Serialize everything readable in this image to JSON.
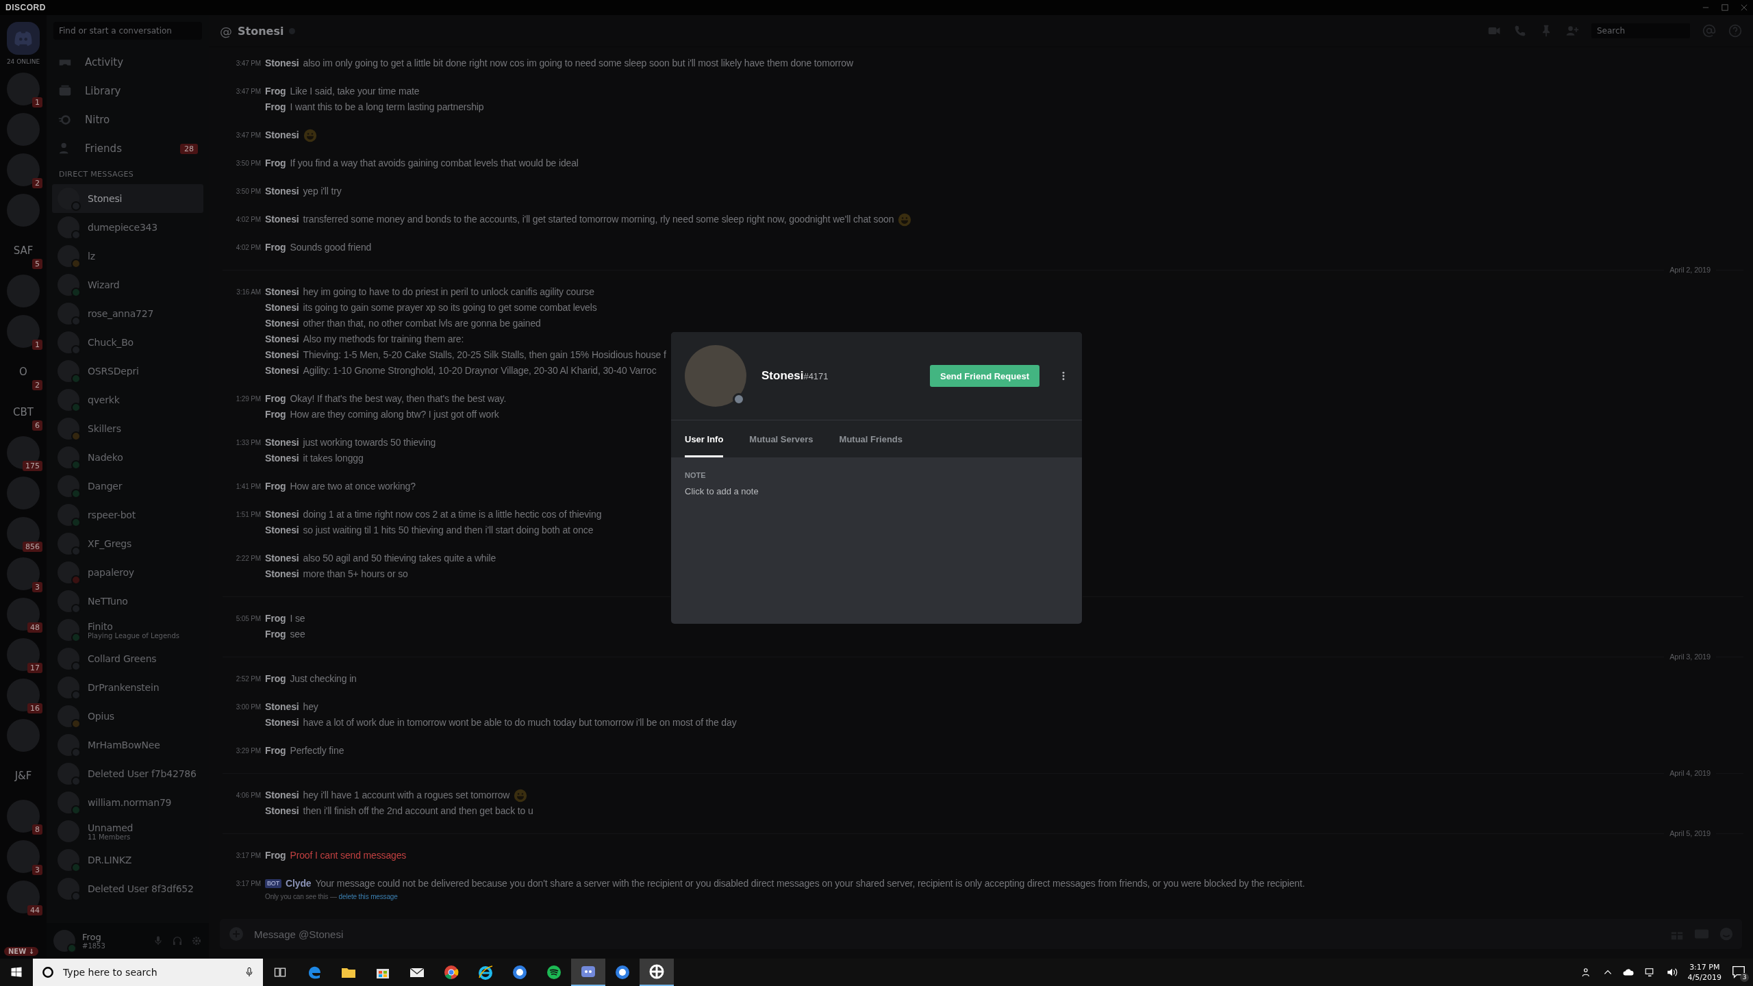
{
  "titlebar": {
    "app_name": "DISCORD"
  },
  "servers": {
    "home_label": "24 ONLINE",
    "new_pill": "NEW ↓",
    "items": [
      {
        "kind": "image",
        "badge": "1"
      },
      {
        "kind": "image"
      },
      {
        "kind": "image",
        "badge": "2"
      },
      {
        "kind": "image"
      },
      {
        "kind": "text",
        "label": "SAF",
        "badge": "5"
      },
      {
        "kind": "image"
      },
      {
        "kind": "image",
        "badge": "1"
      },
      {
        "kind": "text",
        "label": "O",
        "badge": "2"
      },
      {
        "kind": "text",
        "label": "CBT",
        "badge": "6"
      },
      {
        "kind": "image",
        "badge": "175"
      },
      {
        "kind": "image"
      },
      {
        "kind": "image",
        "badge": "856"
      },
      {
        "kind": "image",
        "badge": "3"
      },
      {
        "kind": "image",
        "badge": "48"
      },
      {
        "kind": "image",
        "badge": "17"
      },
      {
        "kind": "image",
        "badge": "16"
      },
      {
        "kind": "image"
      },
      {
        "kind": "text",
        "label": "J&F"
      },
      {
        "kind": "image",
        "badge": "8"
      },
      {
        "kind": "image",
        "badge": "3"
      },
      {
        "kind": "image",
        "badge": "44"
      }
    ]
  },
  "sidebar": {
    "search_placeholder": "Find or start a conversation",
    "nav": [
      {
        "kind": "activity",
        "label": "Activity"
      },
      {
        "kind": "library",
        "label": "Library"
      },
      {
        "kind": "nitro",
        "label": "Nitro"
      },
      {
        "kind": "friends",
        "label": "Friends",
        "badge": "28"
      }
    ],
    "section_title": "DIRECT MESSAGES",
    "dms": [
      {
        "name": "Stonesi",
        "selected": true,
        "color": "#1c1e22"
      },
      {
        "name": "dumepiece343",
        "selected": false,
        "color": "#1c1e22"
      },
      {
        "name": "lz",
        "selected": false,
        "color": "#33260f"
      },
      {
        "name": "Wizard",
        "selected": false,
        "color": "#0f2a1d"
      },
      {
        "name": "rose_anna727",
        "selected": false,
        "color": "#1c1e22"
      },
      {
        "name": "Chuck_Bo",
        "selected": false,
        "color": "#1c1e22"
      },
      {
        "name": "OSRSDepri",
        "selected": false,
        "color": "#0f2a1d"
      },
      {
        "name": "qverkk",
        "selected": false,
        "color": "#0f2a1d"
      },
      {
        "name": "Skillers",
        "selected": false,
        "color": "#33260f"
      },
      {
        "name": "Nadeko",
        "selected": false,
        "color": "#0f2a1d"
      },
      {
        "name": "Danger",
        "selected": false,
        "color": "#0f2a1d"
      },
      {
        "name": "rspeer-bot",
        "selected": false,
        "color": "#0f2a1d"
      },
      {
        "name": "XF_Gregs",
        "selected": false,
        "color": "#1c1e22"
      },
      {
        "name": "papaleroy",
        "selected": false,
        "color": "#3a1111"
      },
      {
        "name": "NeTTuno",
        "selected": false,
        "color": "#1c1e22"
      },
      {
        "name": "Finito",
        "subtitle": "Playing League of Legends",
        "selected": false,
        "color": "#0f2a1d"
      },
      {
        "name": "Collard Greens",
        "selected": false,
        "color": "#1c1e22"
      },
      {
        "name": "DrPrankenstein",
        "selected": false,
        "color": "#1c1e22"
      },
      {
        "name": "Opius",
        "selected": false,
        "color": "#33260f"
      },
      {
        "name": "MrHamBowNee",
        "selected": false,
        "color": "#1c1e22"
      },
      {
        "name": "Deleted User f7b42786",
        "selected": false,
        "color": "#1c1e22"
      },
      {
        "name": "william.norman79",
        "selected": false,
        "color": "#0f2a1d"
      },
      {
        "name": "Unnamed",
        "subtitle": "11 Members",
        "selected": false
      },
      {
        "name": "DR.LINKZ",
        "selected": false,
        "color": "#0f2a1d"
      },
      {
        "name": "Deleted User 8f3df652",
        "selected": false,
        "color": "#1c1e22"
      }
    ]
  },
  "user_panel": {
    "name": "Frog",
    "tag": "#1853"
  },
  "chat": {
    "channel_prefix": "@",
    "channel": "Stonesi",
    "search_placeholder": "Search",
    "input_placeholder": "Message @Stonesi",
    "messages": [
      {
        "kind": "group",
        "time": "3:47 PM",
        "lines": [
          {
            "author": "Stonesi",
            "text": "also im only going to get a little bit done right now cos im going to need some sleep soon but i'll most likely have them done tomorrow",
            "emoji": false,
            "failed": false
          }
        ]
      },
      {
        "kind": "group",
        "time": "3:47 PM",
        "lines": [
          {
            "author": "Frog",
            "text": "Like I said, take your time mate",
            "emoji": false,
            "failed": false
          },
          {
            "author": "Frog",
            "text": "I want this to be a long term lasting partnership",
            "emoji": false,
            "failed": false
          }
        ]
      },
      {
        "kind": "group",
        "time": "3:47 PM",
        "lines": [
          {
            "author": "Stonesi",
            "emoji": true
          }
        ]
      },
      {
        "kind": "group",
        "time": "3:50 PM",
        "lines": [
          {
            "author": "Frog",
            "text": "If you find a way that avoids gaining combat levels that would be ideal",
            "emoji": false,
            "failed": false
          }
        ]
      },
      {
        "kind": "group",
        "time": "3:50 PM",
        "lines": [
          {
            "author": "Stonesi",
            "text": "yep i'll try",
            "emoji": false,
            "failed": false
          }
        ]
      },
      {
        "kind": "group",
        "time": "4:02 PM",
        "lines": [
          {
            "author": "Stonesi",
            "text": "transferred some money and bonds to the accounts, i'll get started tomorrow morning, rly need some sleep right now, goodnight we'll chat soon",
            "emoji": true,
            "failed": false
          }
        ]
      },
      {
        "kind": "group",
        "time": "4:02 PM",
        "lines": [
          {
            "author": "Frog",
            "text": "Sounds good friend",
            "emoji": false,
            "failed": false
          }
        ]
      },
      {
        "kind": "divider",
        "date": "April 2, 2019"
      },
      {
        "kind": "group",
        "time": "3:16 AM",
        "lines": [
          {
            "author": "Stonesi",
            "text": "hey im going to have to do priest in peril to unlock canifis agility course",
            "emoji": false,
            "failed": false
          },
          {
            "author": "Stonesi",
            "text": "its going to gain some prayer xp so its going to get some combat levels",
            "emoji": false,
            "failed": false
          },
          {
            "author": "Stonesi",
            "text": "other than that, no other combat lvls are gonna be gained",
            "emoji": false,
            "failed": false
          },
          {
            "author": "Stonesi",
            "text": "Also my methods for training them are:",
            "emoji": false,
            "failed": false
          },
          {
            "author": "Stonesi",
            "text": "Thieving: 1-5 Men, 5-20 Cake Stalls, 20-25 Silk Stalls, then gain 15% Hosidious house f",
            "emoji": false,
            "failed": false
          },
          {
            "author": "Stonesi",
            "text": "Agility: 1-10 Gnome Stronghold, 10-20 Draynor Village, 20-30 Al Kharid, 30-40 Varroc",
            "emoji": false,
            "failed": false
          }
        ]
      },
      {
        "kind": "group",
        "time": "1:29 PM",
        "lines": [
          {
            "author": "Frog",
            "text": "Okay! If that's the best way, then that's the best way.",
            "emoji": false,
            "failed": false
          },
          {
            "author": "Frog",
            "text": "How are they coming along btw? I just got off work",
            "emoji": false,
            "failed": false
          }
        ]
      },
      {
        "kind": "group",
        "time": "1:33 PM",
        "lines": [
          {
            "author": "Stonesi",
            "text": "just working towards 50 thieving",
            "emoji": false,
            "failed": false
          },
          {
            "author": "Stonesi",
            "text": "it takes longgg",
            "emoji": false,
            "failed": false
          }
        ]
      },
      {
        "kind": "group",
        "time": "1:41 PM",
        "lines": [
          {
            "author": "Frog",
            "text": "How are two at once working?",
            "emoji": false,
            "failed": false
          }
        ]
      },
      {
        "kind": "group",
        "time": "1:51 PM",
        "lines": [
          {
            "author": "Stonesi",
            "text": "doing 1 at a time right now cos 2 at a time is a little hectic cos of thieving",
            "emoji": false,
            "failed": false
          },
          {
            "author": "Stonesi",
            "text": "so just waiting til 1 hits 50 thieving and then i'll start doing both at once",
            "emoji": false,
            "failed": false
          }
        ]
      },
      {
        "kind": "group",
        "time": "2:22 PM",
        "lines": [
          {
            "author": "Stonesi",
            "text": "also 50 agil and 50 thieving takes quite a while",
            "emoji": false,
            "failed": false
          },
          {
            "author": "Stonesi",
            "text": "more than 5+ hours or so",
            "emoji": false,
            "failed": false
          }
        ]
      },
      {
        "kind": "divider"
      },
      {
        "kind": "group",
        "time": "5:05 PM",
        "lines": [
          {
            "author": "Frog",
            "text": "I se",
            "emoji": false,
            "failed": false
          },
          {
            "author": "Frog",
            "text": "see",
            "emoji": false,
            "failed": false
          }
        ]
      },
      {
        "kind": "divider",
        "date": "April 3, 2019"
      },
      {
        "kind": "group",
        "time": "2:52 PM",
        "lines": [
          {
            "author": "Frog",
            "text": "Just checking in",
            "emoji": false,
            "failed": false
          }
        ]
      },
      {
        "kind": "group",
        "time": "3:00 PM",
        "lines": [
          {
            "author": "Stonesi",
            "text": "hey",
            "emoji": false,
            "failed": false
          },
          {
            "author": "Stonesi",
            "text": "have a lot of work due in tomorrow wont be able to do much today but tomorrow i'll be on most of the day",
            "emoji": false,
            "failed": false
          }
        ]
      },
      {
        "kind": "group",
        "time": "3:29 PM",
        "lines": [
          {
            "author": "Frog",
            "text": "Perfectly fine",
            "emoji": false,
            "failed": false
          }
        ]
      },
      {
        "kind": "divider",
        "date": "April 4, 2019"
      },
      {
        "kind": "group",
        "time": "4:06 PM",
        "lines": [
          {
            "author": "Stonesi",
            "text": "hey i'll have 1 account with a rogues set tomorrow",
            "emoji": true,
            "failed": false
          },
          {
            "author": "Stonesi",
            "text": "then i'll finish off the 2nd account and then get back to u",
            "emoji": false,
            "failed": false
          }
        ]
      },
      {
        "kind": "divider",
        "date": "April 5, 2019"
      },
      {
        "kind": "group",
        "time": "3:17 PM",
        "lines": [
          {
            "author": "Frog",
            "text": "Proof I cant send messages",
            "emoji": false,
            "failed": true
          }
        ]
      },
      {
        "kind": "system",
        "time": "3:17 PM",
        "tag": "BOT",
        "author": "Clyde",
        "text": "Your message could not be delivered because you don't share a server with the recipient or you disabled direct messages on your shared server, recipient is only accepting direct messages from friends, or you were blocked by the recipient.",
        "note": "Only you can see this —",
        "note_link": "delete this message"
      }
    ]
  },
  "profile_modal": {
    "username": "Stonesi",
    "discriminator": "#4171",
    "button": "Send Friend Request",
    "tabs": [
      {
        "label": "User Info",
        "selected": true
      },
      {
        "label": "Mutual Servers",
        "selected": false
      },
      {
        "label": "Mutual Friends",
        "selected": false
      }
    ],
    "note_title": "NOTE",
    "note_placeholder": "Click to add a note"
  },
  "taskbar": {
    "search_placeholder": "Type here to search",
    "apps": [
      {
        "kind": "taskview",
        "active": false
      },
      {
        "kind": "edge",
        "active": false
      },
      {
        "kind": "folder",
        "active": false
      },
      {
        "kind": "store",
        "active": false
      },
      {
        "kind": "mail",
        "active": false
      },
      {
        "kind": "chrome",
        "active": false
      },
      {
        "kind": "ie",
        "active": false
      },
      {
        "kind": "blue",
        "active": false
      },
      {
        "kind": "spotify",
        "active": false
      },
      {
        "kind": "discord",
        "active": true
      },
      {
        "kind": "blue",
        "active": false
      },
      {
        "kind": "orange",
        "active": true
      }
    ],
    "time": "3:17 PM",
    "date": "4/5/2019",
    "notifications": "3"
  }
}
